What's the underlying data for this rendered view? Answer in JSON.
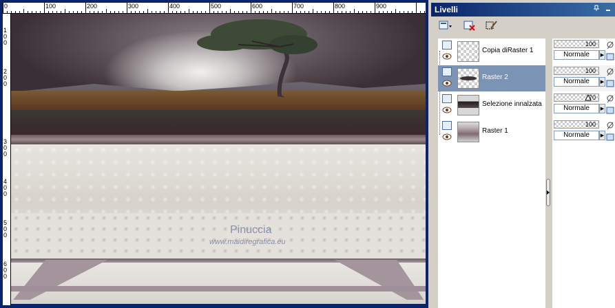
{
  "canvas": {
    "ruler_top_labels": [
      "0",
      "100",
      "200",
      "300",
      "400",
      "500",
      "600",
      "700",
      "800",
      "900"
    ],
    "ruler_left_labels": [
      "1",
      "0",
      "0",
      "2",
      "0",
      "0",
      "3",
      "0",
      "0",
      "4",
      "0",
      "0",
      "5",
      "0",
      "0",
      "6",
      "0",
      "0"
    ],
    "watermark_title": "Pinuccia",
    "watermark_url": "www.maidiregrafica.eu"
  },
  "panel": {
    "title": "Livelli",
    "pin_icon": "pin-icon",
    "minimize_icon": "minimize-icon",
    "toolbar": {
      "new_layer_icon": "new-raster-layer-icon",
      "delete_layer_icon": "delete-layer-icon",
      "edit_selection_icon": "edit-selection-icon"
    },
    "layers": [
      {
        "name": "Copia diRaster 1",
        "selected": false,
        "opacity": "100",
        "blend": "Normale"
      },
      {
        "name": "Raster 2",
        "selected": true,
        "opacity": "100",
        "blend": "Normale"
      },
      {
        "name": "Selezione innalzata",
        "selected": false,
        "opacity": "70",
        "blend": "Normale"
      },
      {
        "name": "Raster 1",
        "selected": false,
        "opacity": "100",
        "blend": "Normale"
      }
    ]
  }
}
